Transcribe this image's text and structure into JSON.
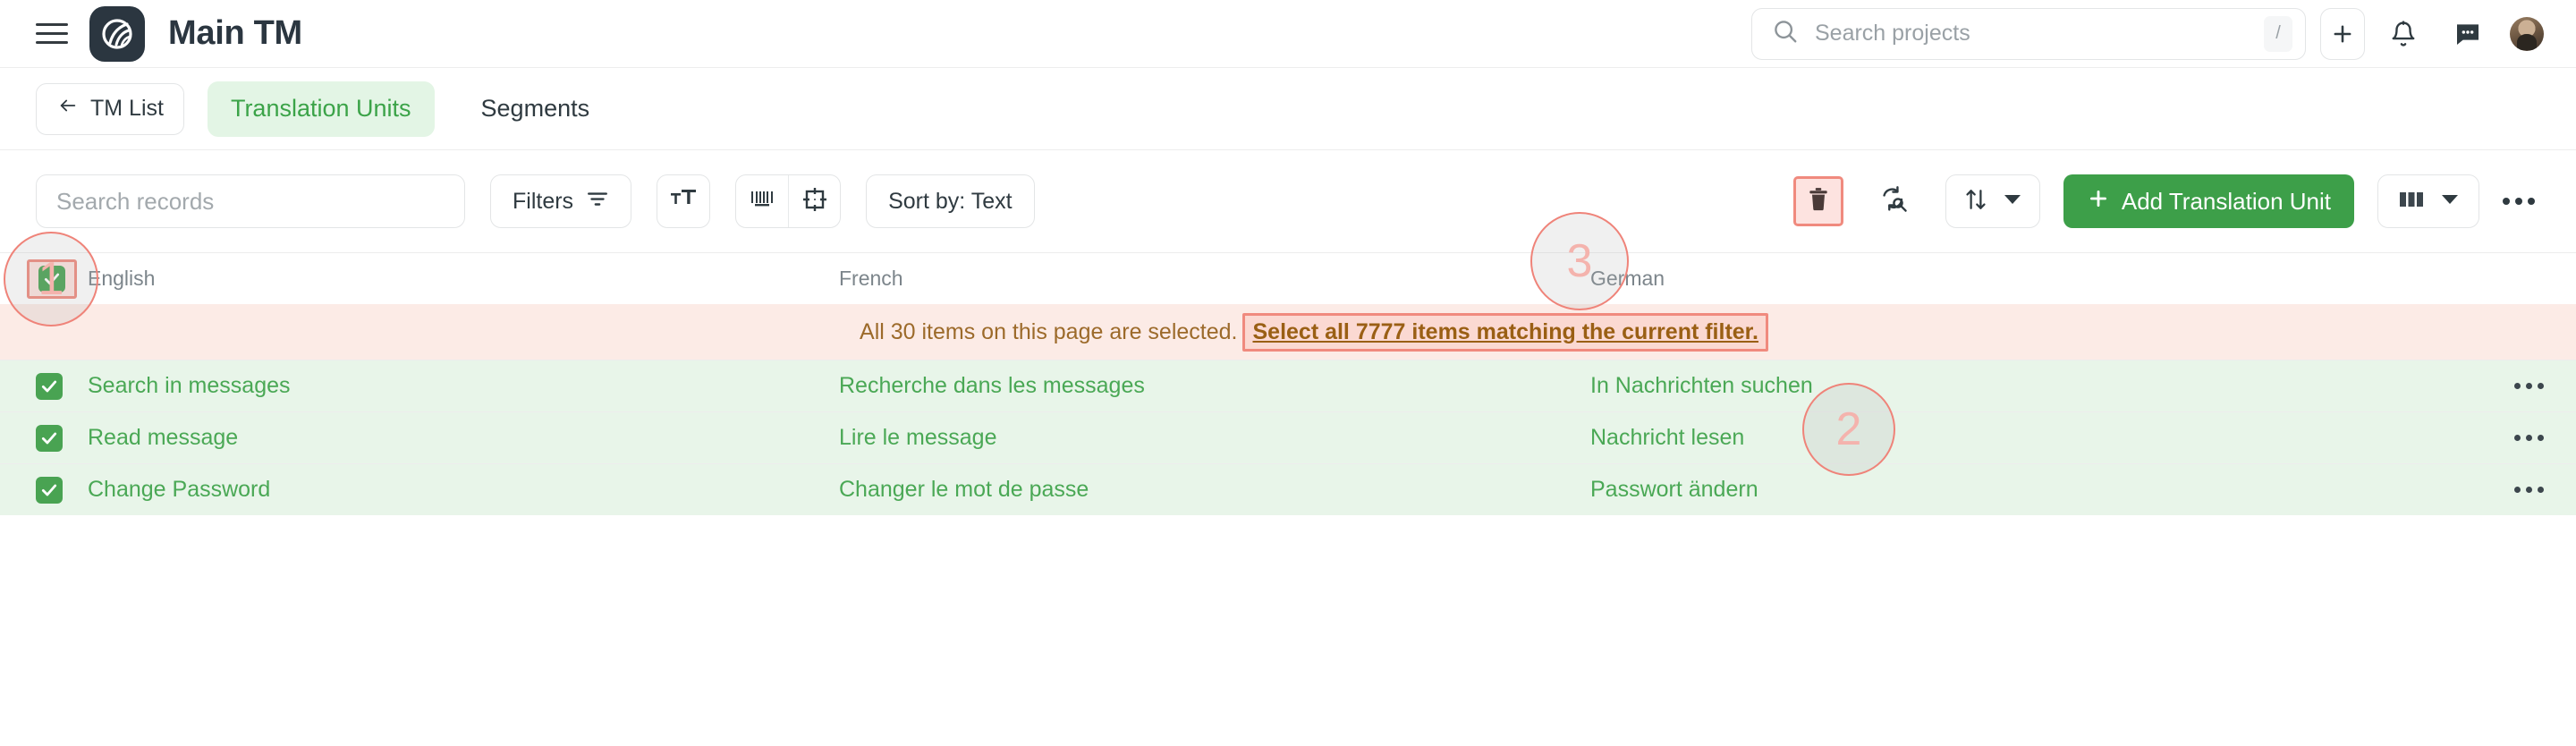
{
  "header": {
    "menu_icon": "hamburger-icon",
    "logo_icon": "app-logo-icon",
    "title": "Main TM",
    "search": {
      "placeholder": "Search projects",
      "value": "",
      "icon": "search-icon",
      "shortcut": "/"
    },
    "add_icon": "plus-icon",
    "notifications_icon": "bell-icon",
    "messages_icon": "chat-icon",
    "avatar_icon": "user-avatar"
  },
  "tabs": {
    "back_label": "TM List",
    "back_icon": "arrow-left-icon",
    "items": [
      {
        "label": "Translation Units",
        "active": true
      },
      {
        "label": "Segments",
        "active": false
      }
    ]
  },
  "toolbar": {
    "search_placeholder": "Search records",
    "search_value": "",
    "filters_label": "Filters",
    "filters_icon": "filter-icon",
    "font_size_icon": "font-size-icon",
    "tag_icon": "barcode-tag-icon",
    "target_icon": "crosshair-target-icon",
    "sort_label": "Sort by: Text",
    "delete_icon": "trash-icon",
    "refresh_search_icon": "refresh-search-icon",
    "sort_direction_icon": "sort-arrows-icon",
    "sort_direction_caret": "chevron-down-icon",
    "add_label": "Add Translation Unit",
    "add_icon": "plus-icon",
    "columns_icon": "columns-icon",
    "columns_caret": "chevron-down-icon",
    "more_icon": "more-horizontal-icon"
  },
  "table": {
    "columns": [
      "English",
      "French",
      "German"
    ],
    "header_checkbox_checked": true,
    "rows": [
      {
        "checked": true,
        "english": "Search in messages",
        "french": "Recherche dans les messages",
        "german": "In Nachrichten suchen",
        "actions_icon": "more-horizontal-icon"
      },
      {
        "checked": true,
        "english": "Read message",
        "french": "Lire le message",
        "german": "Nachricht lesen",
        "actions_icon": "more-horizontal-icon"
      },
      {
        "checked": true,
        "english": "Change Password",
        "french": "Changer le mot de passe",
        "german": "Passwort ändern",
        "actions_icon": "more-horizontal-icon"
      }
    ]
  },
  "selection_banner": {
    "text": "All 30 items on this page are selected.",
    "link": "Select all 7777 items matching the current filter."
  },
  "annotations": [
    {
      "label": "1"
    },
    {
      "label": "2"
    },
    {
      "label": "3"
    }
  ],
  "colors": {
    "accent_green": "#3d9f49",
    "tab_active_bg": "#e3f5e5",
    "row_selected_bg": "#e8f5e9",
    "banner_bg": "#fcebe6",
    "highlight_border": "#f08a7e",
    "logo_bg": "#2b3640"
  }
}
